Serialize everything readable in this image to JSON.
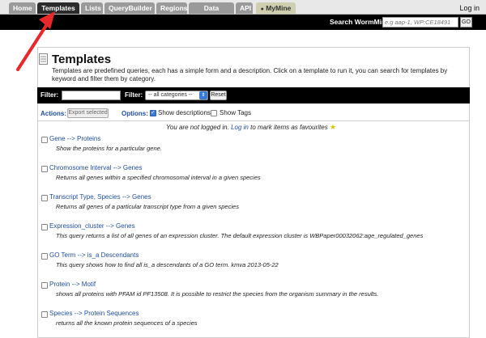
{
  "nav": {
    "tabs": [
      {
        "label": "Home"
      },
      {
        "label": "Templates"
      },
      {
        "label": "Lists"
      },
      {
        "label": "QueryBuilder"
      },
      {
        "label": "Regions"
      },
      {
        "label": "Data Sources"
      },
      {
        "label": "API"
      },
      {
        "label": "MyMine"
      }
    ],
    "login": "Log in"
  },
  "search": {
    "label": "Search WormMine",
    "placeholder": "e.g aap-1, WP:CE18491",
    "go": "GO"
  },
  "page": {
    "title": "Templates",
    "description": "Templates are predefined queries, each has a simple form and a description. Click on a template to run it, you can search for templates by keyword and filter them by category."
  },
  "filters": {
    "filter_label_1": "Filter:",
    "filter_label_2": "Filter:",
    "category_selected": "-- all categories --",
    "reset": "Reset"
  },
  "actions": {
    "actions_label": "Actions:",
    "export_label": "Export selected",
    "options_label": "Options:",
    "show_descriptions": "Show descriptions",
    "show_tags": "Show Tags"
  },
  "notice": {
    "before": "You are not logged in.",
    "link": "Log in",
    "after": "to mark items as favourites"
  },
  "templates": [
    {
      "title": "Gene --> Proteins",
      "desc": "Show the proteins for a particular gene."
    },
    {
      "title": "Chromosome Interval --> Genes",
      "desc": "Returns all genes within a specified chromosomal interval in a given species"
    },
    {
      "title": "Transcript Type, Species --> Genes",
      "desc": "Returns all genes of a particular transcript type from a given species"
    },
    {
      "title": "Expression_cluster --> Genes",
      "desc": "This query returns a list of all genes of an expression cluster. The default expression cluster is WBPaper00032062:age_regulated_genes"
    },
    {
      "title": "GO Term --> is_a Descendants",
      "desc": "This query shows how to find all is_a descendants of a GO term. kmva 2013-05-22"
    },
    {
      "title": "Protein --> Motif",
      "desc": "shows all proteins with PFAM id PF13508. It is possible to restrict the species from the organism summary in the results."
    },
    {
      "title": "Species --> Protein Sequences",
      "desc": "returns all the known protein sequences of a species"
    }
  ],
  "colors": {
    "active_tab": "#2b2b2b",
    "inactive_tab": "#9a9a9a",
    "link_blue": "#1f4e9c",
    "arrow_red": "#e8282b"
  }
}
